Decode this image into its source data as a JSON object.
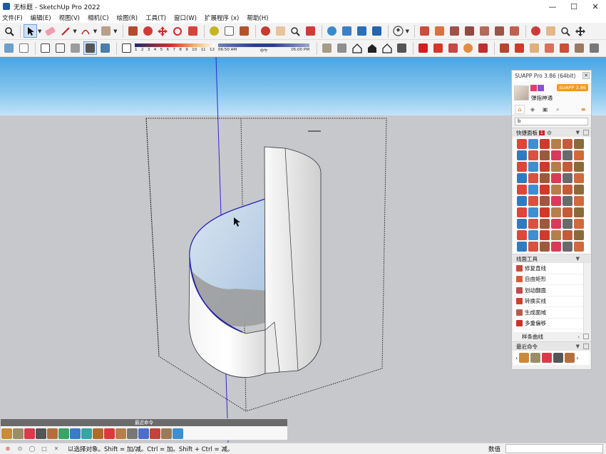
{
  "window": {
    "title": "无标题 - SketchUp Pro 2022",
    "controls": [
      "—",
      "☐",
      "✕"
    ]
  },
  "menu": [
    "文件(F)",
    "编辑(E)",
    "视图(V)",
    "相机(C)",
    "绘图(R)",
    "工具(T)",
    "窗口(W)",
    "扩展程序 (x)",
    "帮助(H)"
  ],
  "shadow": {
    "ticks": [
      "1",
      "2",
      "3",
      "4",
      "5",
      "6",
      "7",
      "8",
      "9",
      "10",
      "11",
      "12"
    ],
    "time_start": "06:50 AM",
    "time_mid": "中午",
    "time_end": "05:00 PM"
  },
  "suapp": {
    "title": "SUAPP Pro 3.86 (64bit)",
    "close": "✕",
    "user_name": "弹指神通",
    "version_badge": "SUAPP 3.86",
    "search_value": "b",
    "quick_panel": {
      "label": "快捷面板",
      "count": "1"
    },
    "line_tools": {
      "label": "线面工具",
      "items": [
        "修复直线",
        "自由矩形",
        "划动翻面",
        "转换实线",
        "生成面域",
        "多重偏移"
      ]
    },
    "spline_label": "样条曲线",
    "recent_label": "最近命令",
    "colors": {
      "badge": "#f29a21",
      "accent": "#e5600b"
    }
  },
  "recent_bar": {
    "title": "最近命令"
  },
  "status": {
    "hint": "以选择对象。Shift = 加/减。Ctrl = 加。Shift + Ctrl = 减。",
    "measure_label": "数值",
    "measure_value": ""
  }
}
